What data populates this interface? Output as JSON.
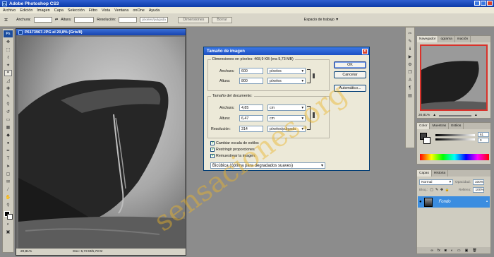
{
  "app": {
    "title": "Adobe Photoshop CS3",
    "icon": "Ps"
  },
  "menu": [
    "Archivo",
    "Edición",
    "Imagen",
    "Capa",
    "Selección",
    "Filtro",
    "Vista",
    "Ventana",
    "onOne",
    "Ayuda"
  ],
  "options": {
    "width_label": "Anchura:",
    "height_label": "Altura:",
    "resolution_label": "Resolución:",
    "resolution_unit": "píxeles/pulgada",
    "front_image": "Dimensiones",
    "clear": "Borrar",
    "workspace": "Espacio de trabajo ▼"
  },
  "document": {
    "title": "P6173967.JPG al 20,8% (Gris/8)",
    "zoom": "20,81%",
    "doc_size": "Doc: 5,73 M/5,73 M"
  },
  "dialog": {
    "title": "Tamaño de imagen",
    "pixel_dims_label": "Dimensiones en píxeles: 468,9 KB (era 5,73 MB)",
    "pixel_width_label": "Anchura:",
    "pixel_width_value": "600",
    "pixel_width_unit": "píxeles",
    "pixel_height_label": "Altura:",
    "pixel_height_value": "800",
    "pixel_height_unit": "píxeles",
    "doc_size_label": "Tamaño del documento:",
    "doc_width_label": "Anchura:",
    "doc_width_value": "4,85",
    "doc_width_unit": "cm",
    "doc_height_label": "Altura:",
    "doc_height_value": "6,47",
    "doc_height_unit": "cm",
    "resolution_label": "Resolución:",
    "resolution_value": "314",
    "resolution_unit": "píxeles/pulgada",
    "scale_styles": "Cambiar escala de estilos",
    "constrain": "Restringir proporciones",
    "resample": "Remuestrear la imagen:",
    "method": "Bicúbica (óptima para degradados suaves)",
    "ok": "OK",
    "cancel": "Cancelar",
    "auto": "Automático..."
  },
  "navigator": {
    "tabs": [
      "Navegador",
      "ograma",
      "mación"
    ],
    "zoom": "20,81%"
  },
  "color_panel": {
    "tabs": [
      "Color",
      "Muestras",
      "Estilos"
    ],
    "r_value": "61",
    "g_value": "0",
    "b_value": "0"
  },
  "layers_panel": {
    "tabs": [
      "Capas",
      "Historia"
    ],
    "blend_mode": "Normal",
    "opacity_label": "Opacidad:",
    "opacity_value": "100%",
    "lock_label": "Bloq.:",
    "fill_label": "Relleno:",
    "fill_value": "100%",
    "layer_name": "Fondo"
  },
  "watermark": "sensaciones.org",
  "colors": {
    "titlebar": "#0b3aa8",
    "selection": "#3b8de0",
    "dialog_bg": "#ece9d8",
    "watermark": "#ebb428"
  }
}
